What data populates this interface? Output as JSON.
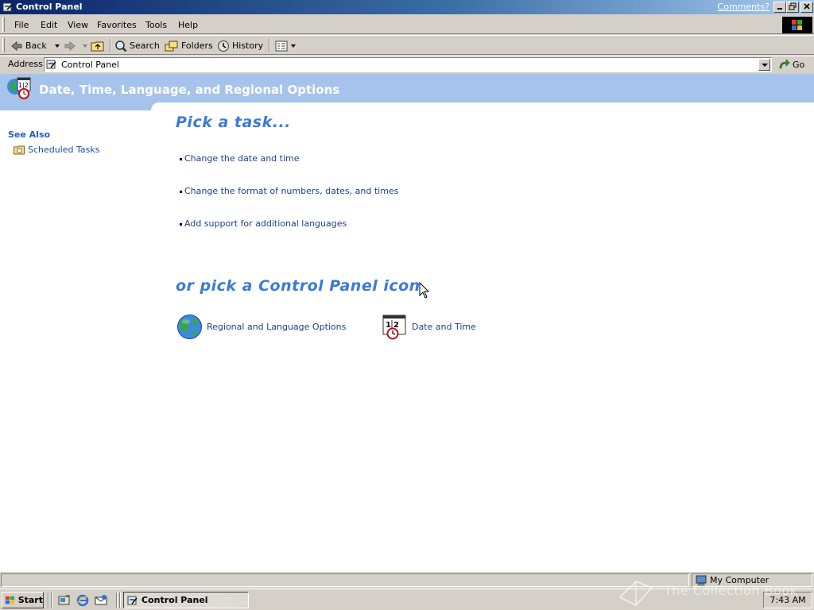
{
  "window": {
    "title": "Control Panel",
    "comments_link": "Comments?"
  },
  "menu": [
    "File",
    "Edit",
    "View",
    "Favorites",
    "Tools",
    "Help"
  ],
  "toolbar": {
    "back": "Back",
    "search": "Search",
    "folders": "Folders",
    "history": "History"
  },
  "address": {
    "label": "Address",
    "value": "Control Panel",
    "go": "Go"
  },
  "banner": {
    "title": "Date, Time, Language, and Regional Options"
  },
  "sidebar": {
    "see_also": "See Also",
    "items": [
      {
        "label": "Scheduled Tasks",
        "icon": "scheduled-tasks-folder-icon"
      }
    ]
  },
  "main": {
    "pick_task": "Pick a task...",
    "tasks": [
      "Change the date and time",
      "Change the format of numbers, dates, and times",
      "Add support for additional languages"
    ],
    "pick_icon": "or pick a Control Panel icon",
    "icons": [
      {
        "label": "Regional and Language Options",
        "icon": "globe-icon"
      },
      {
        "label": "Date and Time",
        "icon": "date-time-icon"
      }
    ]
  },
  "statusbar": {
    "zone": "My Computer"
  },
  "taskbar": {
    "start": "Start",
    "active_window": "Control Panel",
    "clock": "7:43 AM"
  },
  "watermark": "The Collection Book",
  "colors": {
    "titlebar_start": "#0a246a",
    "titlebar_end": "#a6caf0",
    "banner": "#a6c3ec",
    "heading": "#3a7bd5",
    "link": "#1c3f8c",
    "chrome": "#d4d0c8"
  }
}
